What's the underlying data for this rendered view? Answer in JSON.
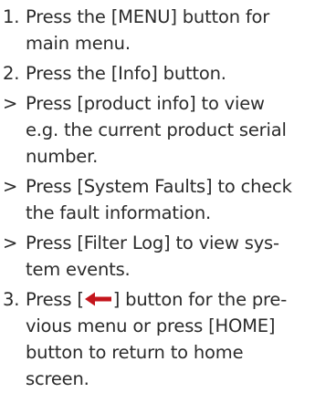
{
  "instructions": {
    "items": [
      {
        "marker": "1.",
        "lines": [
          "Press the [MENU] button for",
          "main menu."
        ]
      },
      {
        "marker": "2.",
        "lines": [
          "Press the [Info] button."
        ]
      },
      {
        "marker": ">",
        "lines": [
          "Press [product info] to view",
          "e.g. the current product serial",
          "number."
        ]
      },
      {
        "marker": ">",
        "lines": [
          "Press [System Faults] to check",
          "the fault information."
        ]
      },
      {
        "marker": ">",
        "lines": [
          "Press [Filter Log] to view sys-",
          "tem events."
        ]
      },
      {
        "marker": "3.",
        "first_line_before": "Press [",
        "first_line_after": "] button for the pre-",
        "lines": [
          "vious menu or press [HOME]",
          "button to return to home",
          "screen."
        ]
      }
    ]
  },
  "icons": {
    "back_arrow": "left-arrow-icon"
  },
  "colors": {
    "text": "#2b2b2b",
    "arrow": "#c4151c"
  }
}
